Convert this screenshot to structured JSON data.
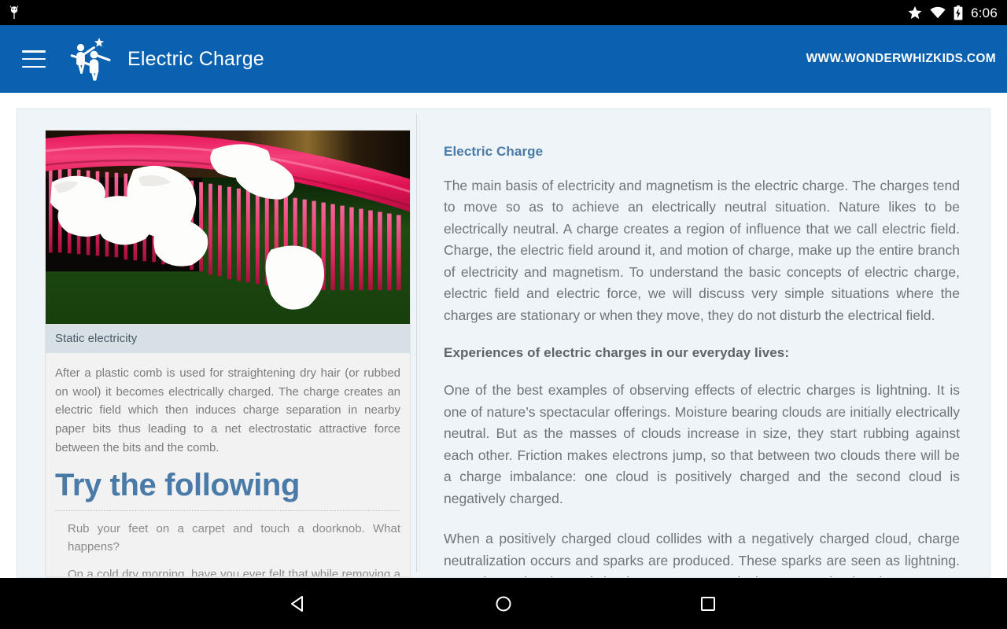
{
  "statusbar": {
    "android_icon": "android-robot-icon",
    "icons": [
      "star-icon",
      "wifi-icon",
      "battery-charging-icon"
    ],
    "time": "6:06"
  },
  "appbar": {
    "menu_icon": "hamburger-menu-icon",
    "logo_icon": "wonderwhizkids-logo-icon",
    "title": "Electric Charge",
    "site_url": "WWW.WONDERWHIZKIDS.COM",
    "background_color": "#0a61b0"
  },
  "left_panel": {
    "image_alt": "pink-comb-attracting-paper-bits-photo",
    "caption": "Static electricity",
    "paragraph": "After a plastic comb is used for straightening dry hair (or rubbed on wool) it becomes electrically charged. The charge creates an electric field which then induces charge separation in nearby paper bits thus leading to a net electrostatic attractive force between the bits and the comb.",
    "try_heading": "Try the following",
    "try_items": [
      "Rub your feet on a carpet and touch a doorknob. What happens?",
      "On a cold dry morning, have you ever felt that while removing a pullover, the hair on your hands stand up?"
    ]
  },
  "right_panel": {
    "heading": "Electric Charge",
    "paragraph_1": "The main basis of electricity and magnetism is the electric charge. The charges tend to move so as to achieve an electrically neutral situation. Nature likes to be electrically neutral. A charge creates a region of influence that we call electric field. Charge, the electric field around it, and motion of charge, make up the entire branch of electricity and magnetism. To understand the basic concepts of electric charge, electric field and electric force, we will discuss very simple situations where the charges are stationary or when they move, they do not disturb the electrical field.",
    "subheading": "Experiences of electric charges in our everyday lives:",
    "paragraph_2": "One of the best examples of observing effects of electric charges is lightning. It is one of nature’s spectacular offerings. Moisture bearing clouds are initially electrically neutral. But as the masses of clouds increase in size, they start rubbing against each other. Friction makes electrons jump, so that between two clouds there will be a charge imbalance: one cloud is positively charged and the second cloud is negatively charged.",
    "paragraph_3": "When a positively charged cloud collides with a negatively charged cloud, charge neutralization occurs and sparks are produced. These sparks are seen as lightning. Sometimes, the charged clouds may cause sparks between a cloud and"
  },
  "navbar": {
    "back_icon": "back-triangle-icon",
    "home_icon": "home-circle-icon",
    "recents_icon": "recents-square-icon"
  },
  "colors": {
    "brand_blue": "#0a61b0",
    "heading_blue": "#4a7aa7",
    "card_background": "#eef4f7",
    "caption_background": "#d7e1e5",
    "body_text": "#6f7479"
  }
}
